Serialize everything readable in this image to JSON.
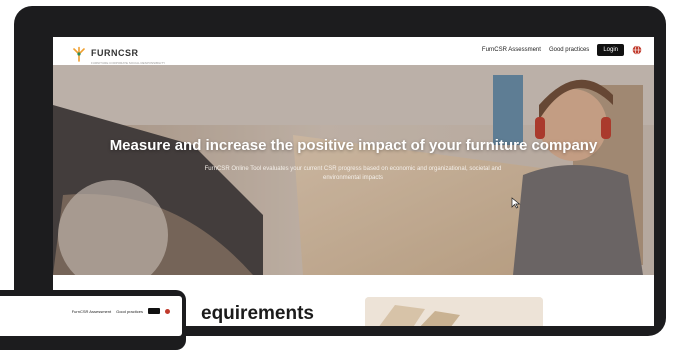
{
  "header": {
    "logo_text": "FURNCSR",
    "logo_subtext": "FURNITURE CORPORATE SOCIAL RESPONSIBILITY",
    "nav": [
      {
        "label": "FurnCSR Assessment"
      },
      {
        "label": "Good practices"
      }
    ],
    "login_label": "Login"
  },
  "hero": {
    "title": "Measure and increase the positive impact of your furniture company",
    "description": "FurnCSR Online Tool evaluates your current CSR progress based on economic and organizational, societal and environmental impacts"
  },
  "content": {
    "heading_partial": "equirements"
  },
  "tablet": {
    "nav": [
      {
        "label": "FurnCSR Assessment"
      },
      {
        "label": "Good practices"
      }
    ]
  },
  "colors": {
    "accent_logo": "#f0a030",
    "login_bg": "#111111",
    "globe": "#c0392b"
  },
  "icons": [
    "logo-mark-icon",
    "globe-icon",
    "cursor-icon"
  ]
}
